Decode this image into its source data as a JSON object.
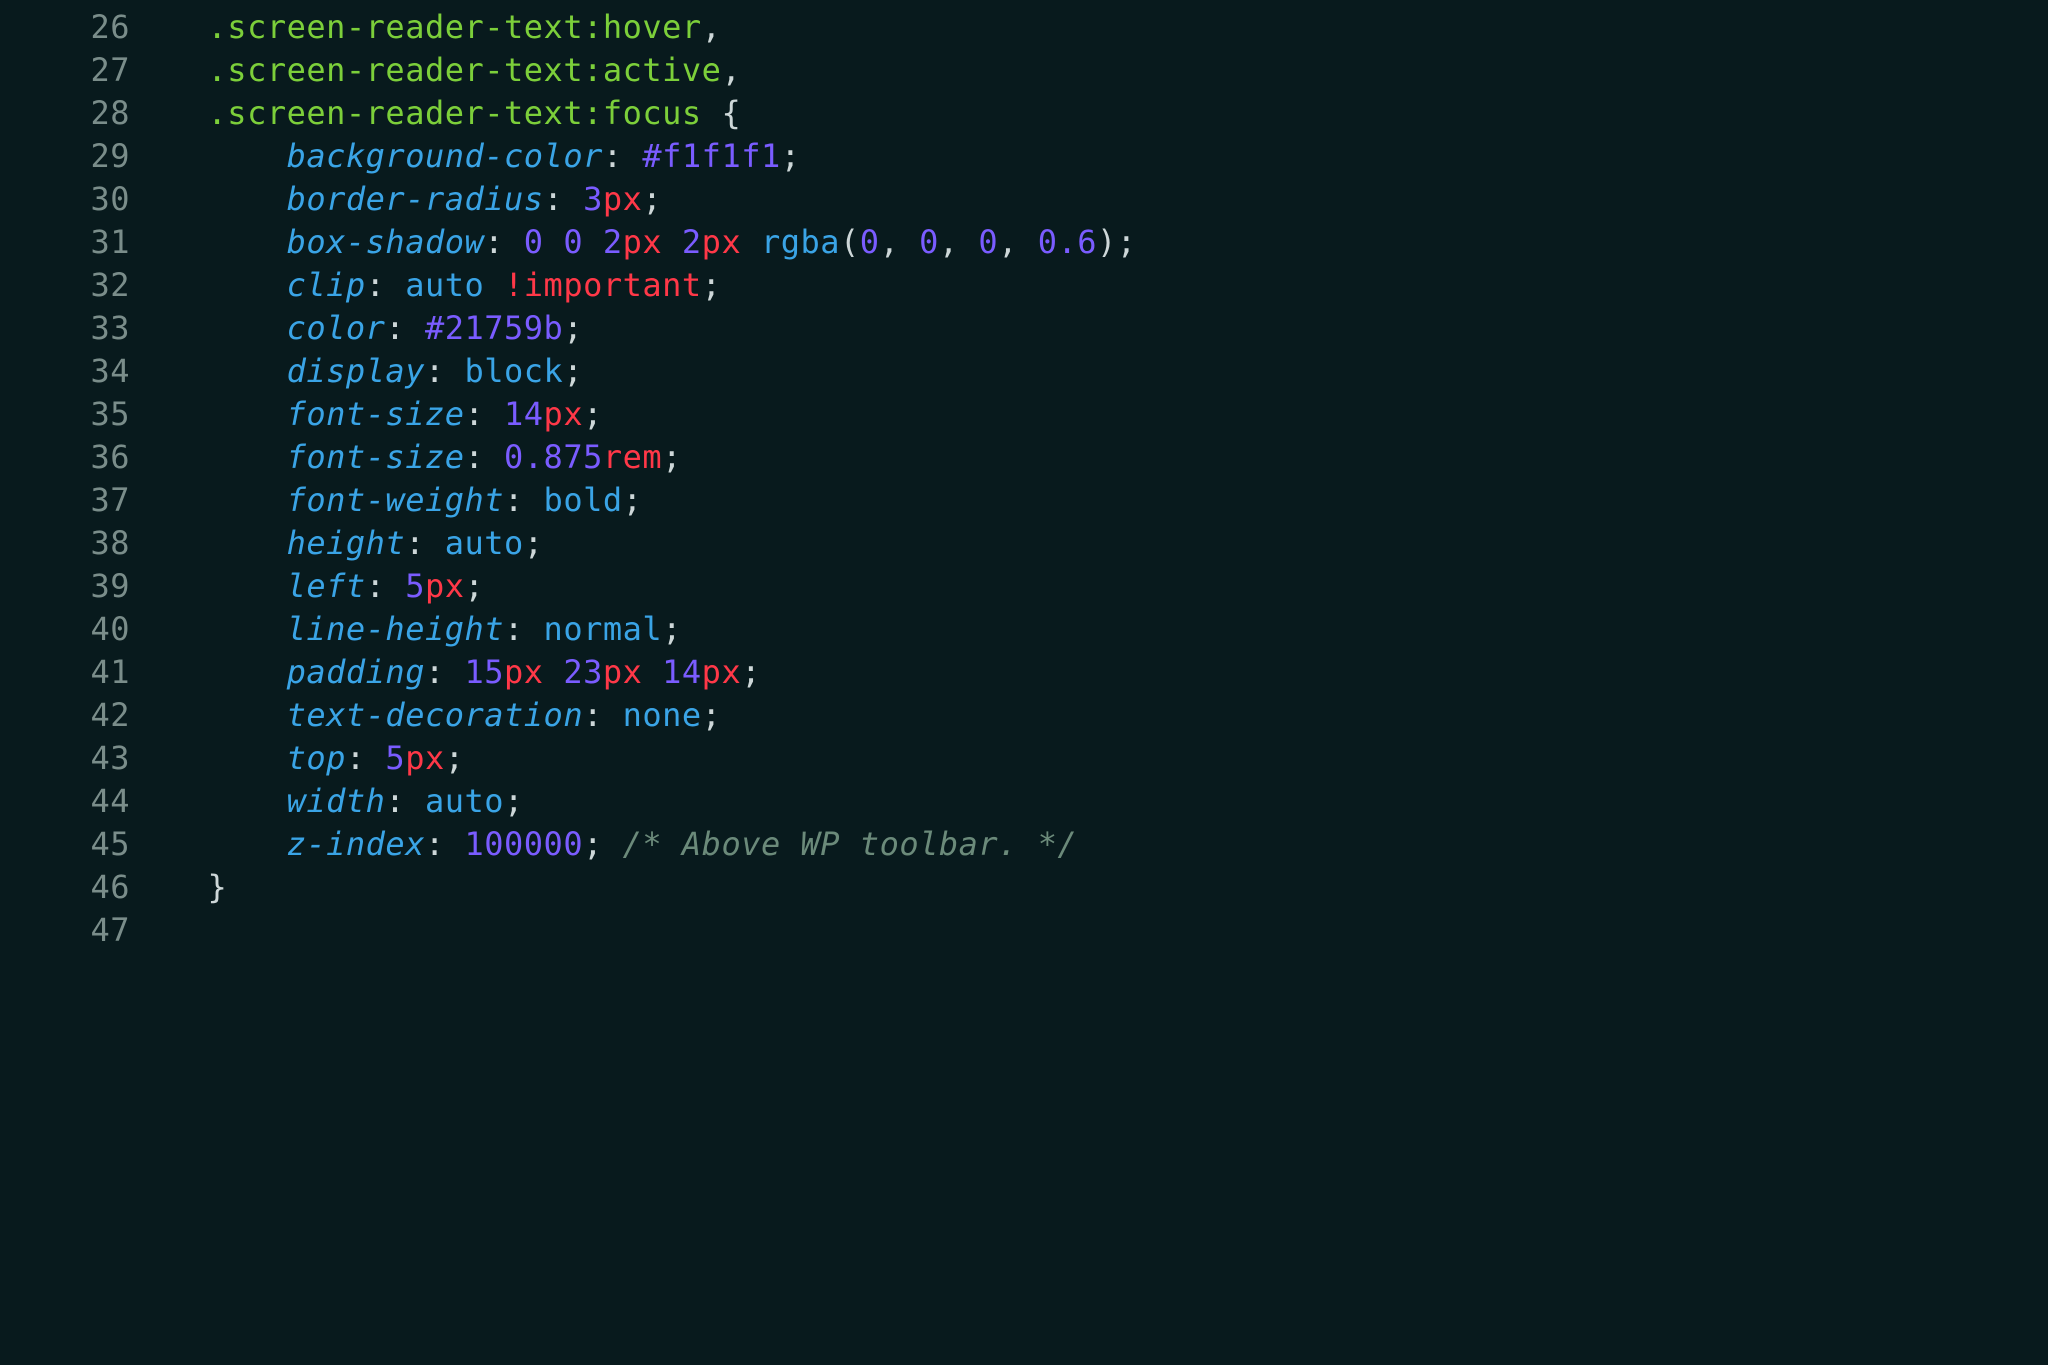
{
  "lines": [
    {
      "n": "26",
      "t": "sel1",
      "sel": ".screen-reader-text",
      "ps": ":hover",
      "end": ","
    },
    {
      "n": "27",
      "t": "sel1",
      "sel": ".screen-reader-text",
      "ps": ":active",
      "end": ","
    },
    {
      "n": "28",
      "t": "sel1",
      "sel": ".screen-reader-text",
      "ps": ":focus",
      "end": " {"
    },
    {
      "n": "29",
      "t": "prop",
      "prop": "background-color",
      "segs": [
        {
          "c": "hex",
          "v": "#f1f1f1"
        }
      ]
    },
    {
      "n": "30",
      "t": "prop",
      "prop": "border-radius",
      "segs": [
        {
          "c": "num",
          "v": "3"
        },
        {
          "c": "unit",
          "v": "px"
        }
      ]
    },
    {
      "n": "31",
      "t": "prop",
      "prop": "box-shadow",
      "segs": [
        {
          "c": "num",
          "v": "0"
        },
        {
          "c": "punc",
          "v": " "
        },
        {
          "c": "num",
          "v": "0"
        },
        {
          "c": "punc",
          "v": " "
        },
        {
          "c": "num",
          "v": "2"
        },
        {
          "c": "unit",
          "v": "px"
        },
        {
          "c": "punc",
          "v": " "
        },
        {
          "c": "num",
          "v": "2"
        },
        {
          "c": "unit",
          "v": "px"
        },
        {
          "c": "punc",
          "v": " "
        },
        {
          "c": "fn",
          "v": "rgba"
        },
        {
          "c": "punc",
          "v": "("
        },
        {
          "c": "num",
          "v": "0"
        },
        {
          "c": "punc",
          "v": ", "
        },
        {
          "c": "num",
          "v": "0"
        },
        {
          "c": "punc",
          "v": ", "
        },
        {
          "c": "num",
          "v": "0"
        },
        {
          "c": "punc",
          "v": ", "
        },
        {
          "c": "num",
          "v": "0.6"
        },
        {
          "c": "punc",
          "v": ")"
        }
      ]
    },
    {
      "n": "32",
      "t": "prop",
      "prop": "clip",
      "segs": [
        {
          "c": "kw",
          "v": "auto"
        },
        {
          "c": "punc",
          "v": " "
        },
        {
          "c": "imp",
          "v": "!important"
        }
      ]
    },
    {
      "n": "33",
      "t": "prop",
      "prop": "color",
      "segs": [
        {
          "c": "hex",
          "v": "#21759b"
        }
      ]
    },
    {
      "n": "34",
      "t": "prop",
      "prop": "display",
      "segs": [
        {
          "c": "kw",
          "v": "block"
        }
      ]
    },
    {
      "n": "35",
      "t": "prop",
      "prop": "font-size",
      "segs": [
        {
          "c": "num",
          "v": "14"
        },
        {
          "c": "unit",
          "v": "px"
        }
      ]
    },
    {
      "n": "36",
      "t": "prop",
      "prop": "font-size",
      "segs": [
        {
          "c": "num",
          "v": "0.875"
        },
        {
          "c": "unit",
          "v": "rem"
        }
      ]
    },
    {
      "n": "37",
      "t": "prop",
      "prop": "font-weight",
      "segs": [
        {
          "c": "kw",
          "v": "bold"
        }
      ]
    },
    {
      "n": "38",
      "t": "prop",
      "prop": "height",
      "segs": [
        {
          "c": "kw",
          "v": "auto"
        }
      ]
    },
    {
      "n": "39",
      "t": "prop",
      "prop": "left",
      "segs": [
        {
          "c": "num",
          "v": "5"
        },
        {
          "c": "unit",
          "v": "px"
        }
      ]
    },
    {
      "n": "40",
      "t": "prop",
      "prop": "line-height",
      "segs": [
        {
          "c": "kw",
          "v": "normal"
        }
      ]
    },
    {
      "n": "41",
      "t": "prop",
      "prop": "padding",
      "segs": [
        {
          "c": "num",
          "v": "15"
        },
        {
          "c": "unit",
          "v": "px"
        },
        {
          "c": "punc",
          "v": " "
        },
        {
          "c": "num",
          "v": "23"
        },
        {
          "c": "unit",
          "v": "px"
        },
        {
          "c": "punc",
          "v": " "
        },
        {
          "c": "num",
          "v": "14"
        },
        {
          "c": "unit",
          "v": "px"
        }
      ]
    },
    {
      "n": "42",
      "t": "prop",
      "prop": "text-decoration",
      "segs": [
        {
          "c": "kw",
          "v": "none"
        }
      ]
    },
    {
      "n": "43",
      "t": "prop",
      "prop": "top",
      "segs": [
        {
          "c": "num",
          "v": "5"
        },
        {
          "c": "unit",
          "v": "px"
        }
      ]
    },
    {
      "n": "44",
      "t": "prop",
      "prop": "width",
      "segs": [
        {
          "c": "kw",
          "v": "auto"
        }
      ]
    },
    {
      "n": "45",
      "t": "prop",
      "prop": "z-index",
      "segs": [
        {
          "c": "num",
          "v": "100000"
        }
      ],
      "comment": "/* Above WP toolbar. */"
    },
    {
      "n": "46",
      "t": "close"
    },
    {
      "n": "47",
      "t": "blank"
    }
  ]
}
